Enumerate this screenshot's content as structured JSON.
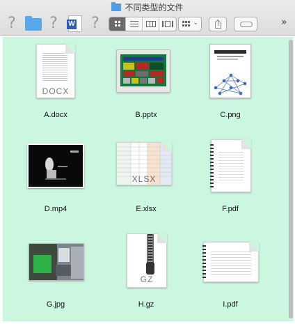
{
  "window": {
    "title": "不同类型的文件"
  },
  "toolbar": {
    "help_glyph": "?",
    "word_badge": "W",
    "more_glyph": "»"
  },
  "files": [
    {
      "name": "A.docx",
      "ext": "DOCX"
    },
    {
      "name": "B.pptx"
    },
    {
      "name": "C.png"
    },
    {
      "name": "D.mp4"
    },
    {
      "name": "E.xlsx",
      "ext": "XLSX"
    },
    {
      "name": "F.pdf"
    },
    {
      "name": "G.jpg"
    },
    {
      "name": "H.gz",
      "ext": "GZ"
    },
    {
      "name": "I.pdf"
    }
  ],
  "colors": {
    "content_background": "#cbf7e0",
    "folder_blue": "#58a9ec",
    "word_blue": "#2b5bb5"
  }
}
